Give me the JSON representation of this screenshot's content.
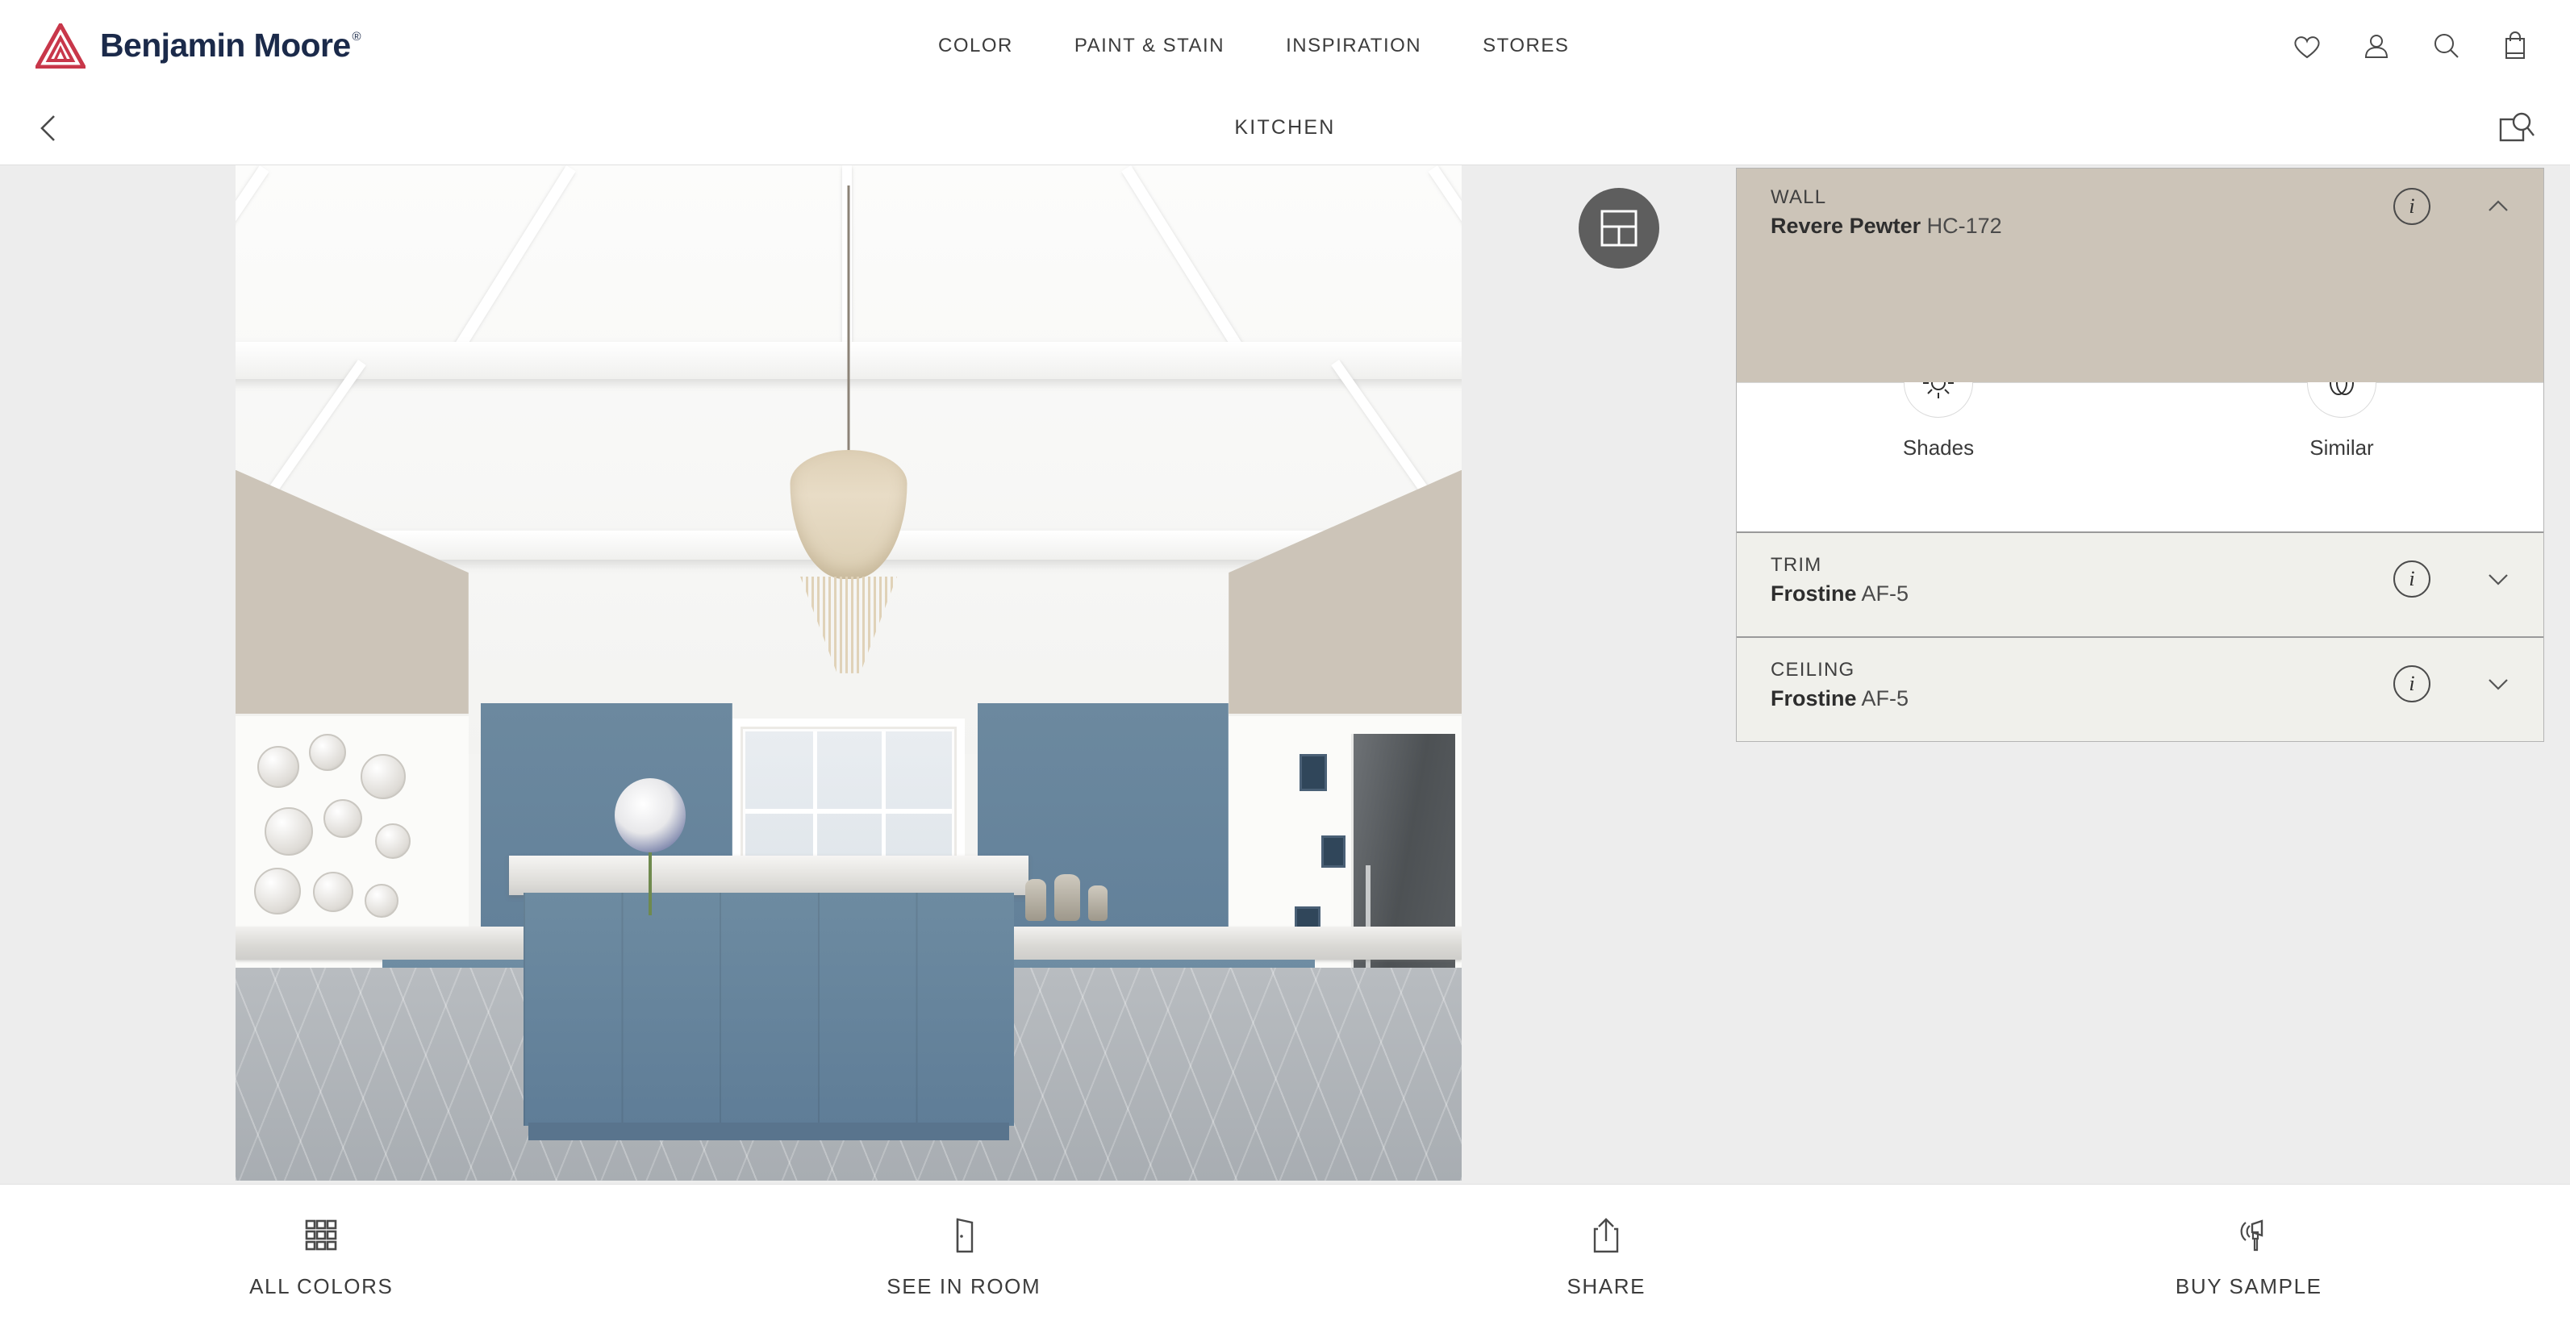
{
  "brand": {
    "name": "Benjamin Moore",
    "registered": "®",
    "logo_icon": "benjamin-moore-triangle-logo",
    "logo_color": "#C8374A",
    "text_color": "#1B2A4A"
  },
  "header": {
    "nav": [
      {
        "label": "COLOR",
        "icon": "color-nav-item"
      },
      {
        "label": "PAINT & STAIN",
        "icon": "paint-stain-nav-item"
      },
      {
        "label": "INSPIRATION",
        "icon": "inspiration-nav-item"
      },
      {
        "label": "STORES",
        "icon": "stores-nav-item"
      }
    ],
    "icons": [
      {
        "name": "heart-icon",
        "label": "Favorites"
      },
      {
        "name": "user-icon",
        "label": "Account"
      },
      {
        "name": "search-icon",
        "label": "Search"
      },
      {
        "name": "shopping-bag-icon",
        "label": "Cart"
      }
    ]
  },
  "subheader": {
    "back_icon": "chevron-left-icon",
    "title": "KITCHEN",
    "zoom_icon": "zoom-image-icon"
  },
  "room": {
    "scene": "kitchen-rendering",
    "wall_color_hex": "#CCC4B8",
    "cabinet_color_hex": "#6D8BA1",
    "trim_color_hex": "#FBFBF9",
    "floor_color_hex": "#AFB4B9"
  },
  "layout_fab": {
    "icon": "layout-grid-icon",
    "background_hex": "#5E5E5E"
  },
  "color_panel": {
    "rows": [
      {
        "surface": "WALL",
        "color_name": "Revere Pewter",
        "color_code": "HC-172",
        "swatch_hex": "#CCC4B8",
        "expanded": true,
        "chevron": "chevron-up-icon",
        "info_icon": "info-icon"
      },
      {
        "surface": "TRIM",
        "color_name": "Frostine",
        "color_code": "AF-5",
        "swatch_hex": "#F0F0EB",
        "expanded": false,
        "chevron": "chevron-down-icon",
        "info_icon": "info-icon"
      },
      {
        "surface": "CEILING",
        "color_name": "Frostine",
        "color_code": "AF-5",
        "swatch_hex": "#F0F0EB",
        "expanded": false,
        "chevron": "chevron-down-icon",
        "info_icon": "info-icon"
      }
    ],
    "tools": [
      {
        "label": "Shades",
        "icon": "sun-brightness-icon"
      },
      {
        "label": "Similar",
        "icon": "overlapping-circles-icon"
      }
    ]
  },
  "bottom_bar": {
    "buttons": [
      {
        "label": "ALL COLORS",
        "icon": "grid-3x3-icon"
      },
      {
        "label": "SEE IN ROOM",
        "icon": "door-icon"
      },
      {
        "label": "SHARE",
        "icon": "share-upload-icon"
      },
      {
        "label": "BUY SAMPLE",
        "icon": "paint-brush-icon"
      }
    ]
  }
}
